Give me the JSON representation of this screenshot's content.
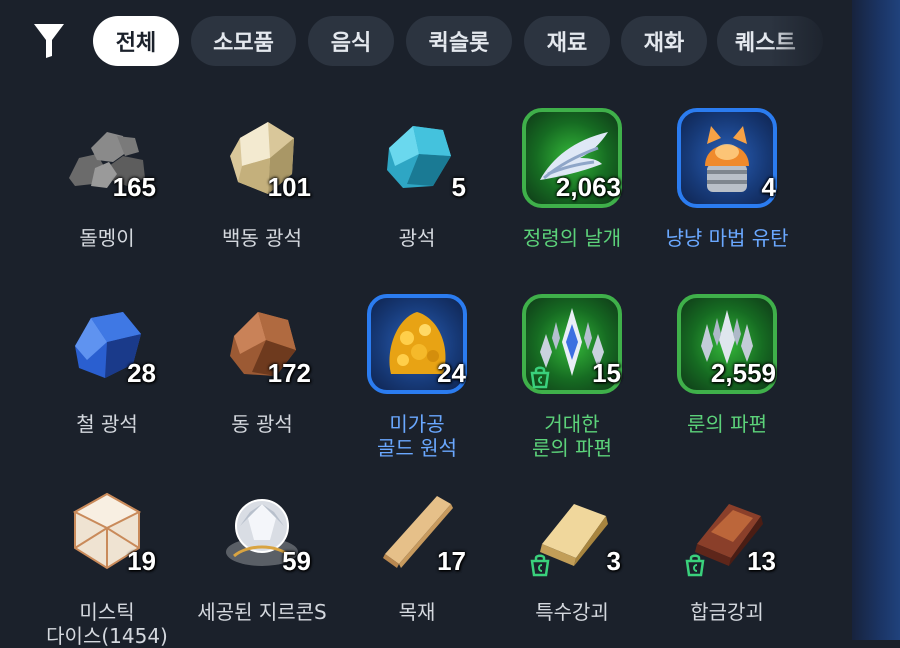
{
  "filter_icon": "filter-funnel-icon",
  "tabs": [
    {
      "label": "전체",
      "active": true
    },
    {
      "label": "소모품",
      "active": false
    },
    {
      "label": "음식",
      "active": false
    },
    {
      "label": "퀵슬롯",
      "active": false
    },
    {
      "label": "재료",
      "active": false
    },
    {
      "label": "재화",
      "active": false
    },
    {
      "label": "퀘스트",
      "active": false
    }
  ],
  "items": [
    {
      "name": "돌멩이",
      "count": "165",
      "icon": "stone-pile-icon",
      "frame": "none"
    },
    {
      "name": "백동 광석",
      "count": "101",
      "icon": "white-copper-ore-icon",
      "frame": "none"
    },
    {
      "name": "광석",
      "count": "5",
      "icon": "blue-ore-icon",
      "frame": "none"
    },
    {
      "name": "정령의 날개",
      "count": "2,063",
      "icon": "spirit-wing-icon",
      "frame": "green"
    },
    {
      "name": "냥냥 마법 유탄",
      "count": "4",
      "icon": "cat-magic-grenade-icon",
      "frame": "blue"
    },
    {
      "name": "철 광석",
      "count": "28",
      "icon": "iron-ore-icon",
      "frame": "none"
    },
    {
      "name": "동 광석",
      "count": "172",
      "icon": "copper-ore-icon",
      "frame": "none"
    },
    {
      "name_line1": "미가공",
      "name_line2": "골드 원석",
      "count": "24",
      "icon": "raw-gold-ore-icon",
      "frame": "blue"
    },
    {
      "name_line1": "거대한",
      "name_line2": "룬의 파편",
      "count": "15",
      "icon": "giant-rune-shard-icon",
      "frame": "green",
      "badge": "trade-bag-icon"
    },
    {
      "name": "룬의 파편",
      "count": "2,559",
      "icon": "rune-shard-icon",
      "frame": "green"
    },
    {
      "name_line1": "미스틱",
      "name_line2": "다이스(1454)",
      "count": "19",
      "icon": "mystic-dice-icon",
      "frame": "none"
    },
    {
      "name": "세공된 지르콘S",
      "count": "59",
      "icon": "cut-zircon-icon",
      "frame": "none"
    },
    {
      "name": "목재",
      "count": "17",
      "icon": "wood-plank-icon",
      "frame": "none"
    },
    {
      "name": "특수강괴",
      "count": "3",
      "icon": "special-steel-ingot-icon",
      "frame": "none",
      "badge": "trade-bag-icon"
    },
    {
      "name": "합금강괴",
      "count": "13",
      "icon": "alloy-steel-ingot-icon",
      "frame": "none",
      "badge": "trade-bag-icon"
    }
  ],
  "colors": {
    "background": "#1b212b",
    "tab_bg": "#2c3440",
    "tab_active_bg": "#ffffff",
    "rare_green": "#3fb04a",
    "rare_blue": "#2b7cf0",
    "name_green": "#5cd27a",
    "name_blue": "#6aa8ff",
    "name_default": "#d4d8de"
  }
}
